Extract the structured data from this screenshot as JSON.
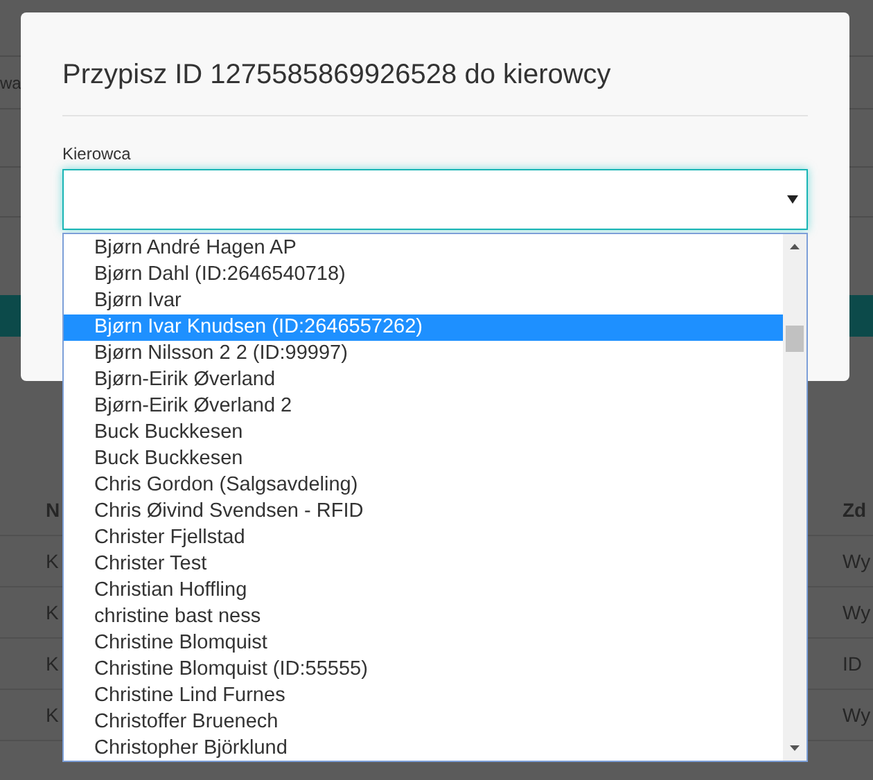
{
  "background_page": {
    "header_fragment": "wa",
    "table": {
      "columns": [
        "N",
        "Zd"
      ],
      "rows": [
        [
          "K",
          "Wy"
        ],
        [
          "K",
          "Wy"
        ],
        [
          "K",
          "ID"
        ],
        [
          "K",
          "Wy"
        ]
      ]
    }
  },
  "modal": {
    "title": "Przypisz ID 1275585869926528 do kierowcy",
    "field": {
      "label": "Kierowca",
      "expanded": true
    },
    "options": [
      {
        "label": "Bjørn André Hagen AP",
        "selected": false
      },
      {
        "label": "Bjørn Dahl (ID:2646540718)",
        "selected": false
      },
      {
        "label": "Bjørn Ivar",
        "selected": false
      },
      {
        "label": "Bjørn Ivar Knudsen (ID:2646557262)",
        "selected": true
      },
      {
        "label": "Bjørn Nilsson 2 2 (ID:99997)",
        "selected": false
      },
      {
        "label": "Bjørn-Eirik Øverland",
        "selected": false
      },
      {
        "label": "Bjørn-Eirik Øverland 2",
        "selected": false
      },
      {
        "label": "Buck Buckkesen",
        "selected": false
      },
      {
        "label": "Buck Buckkesen",
        "selected": false
      },
      {
        "label": "Chris Gordon (Salgsavdeling)",
        "selected": false
      },
      {
        "label": "Chris Øivind Svendsen - RFID",
        "selected": false
      },
      {
        "label": "Christer Fjellstad",
        "selected": false
      },
      {
        "label": "Christer Test",
        "selected": false
      },
      {
        "label": "Christian Hoffling",
        "selected": false
      },
      {
        "label": "christine bast ness",
        "selected": false
      },
      {
        "label": "Christine Blomquist",
        "selected": false
      },
      {
        "label": "Christine Blomquist (ID:55555)",
        "selected": false
      },
      {
        "label": "Christine Lind Furnes",
        "selected": false
      },
      {
        "label": "Christoffer Bruenech",
        "selected": false
      },
      {
        "label": "Christopher Björklund",
        "selected": false
      }
    ]
  }
}
